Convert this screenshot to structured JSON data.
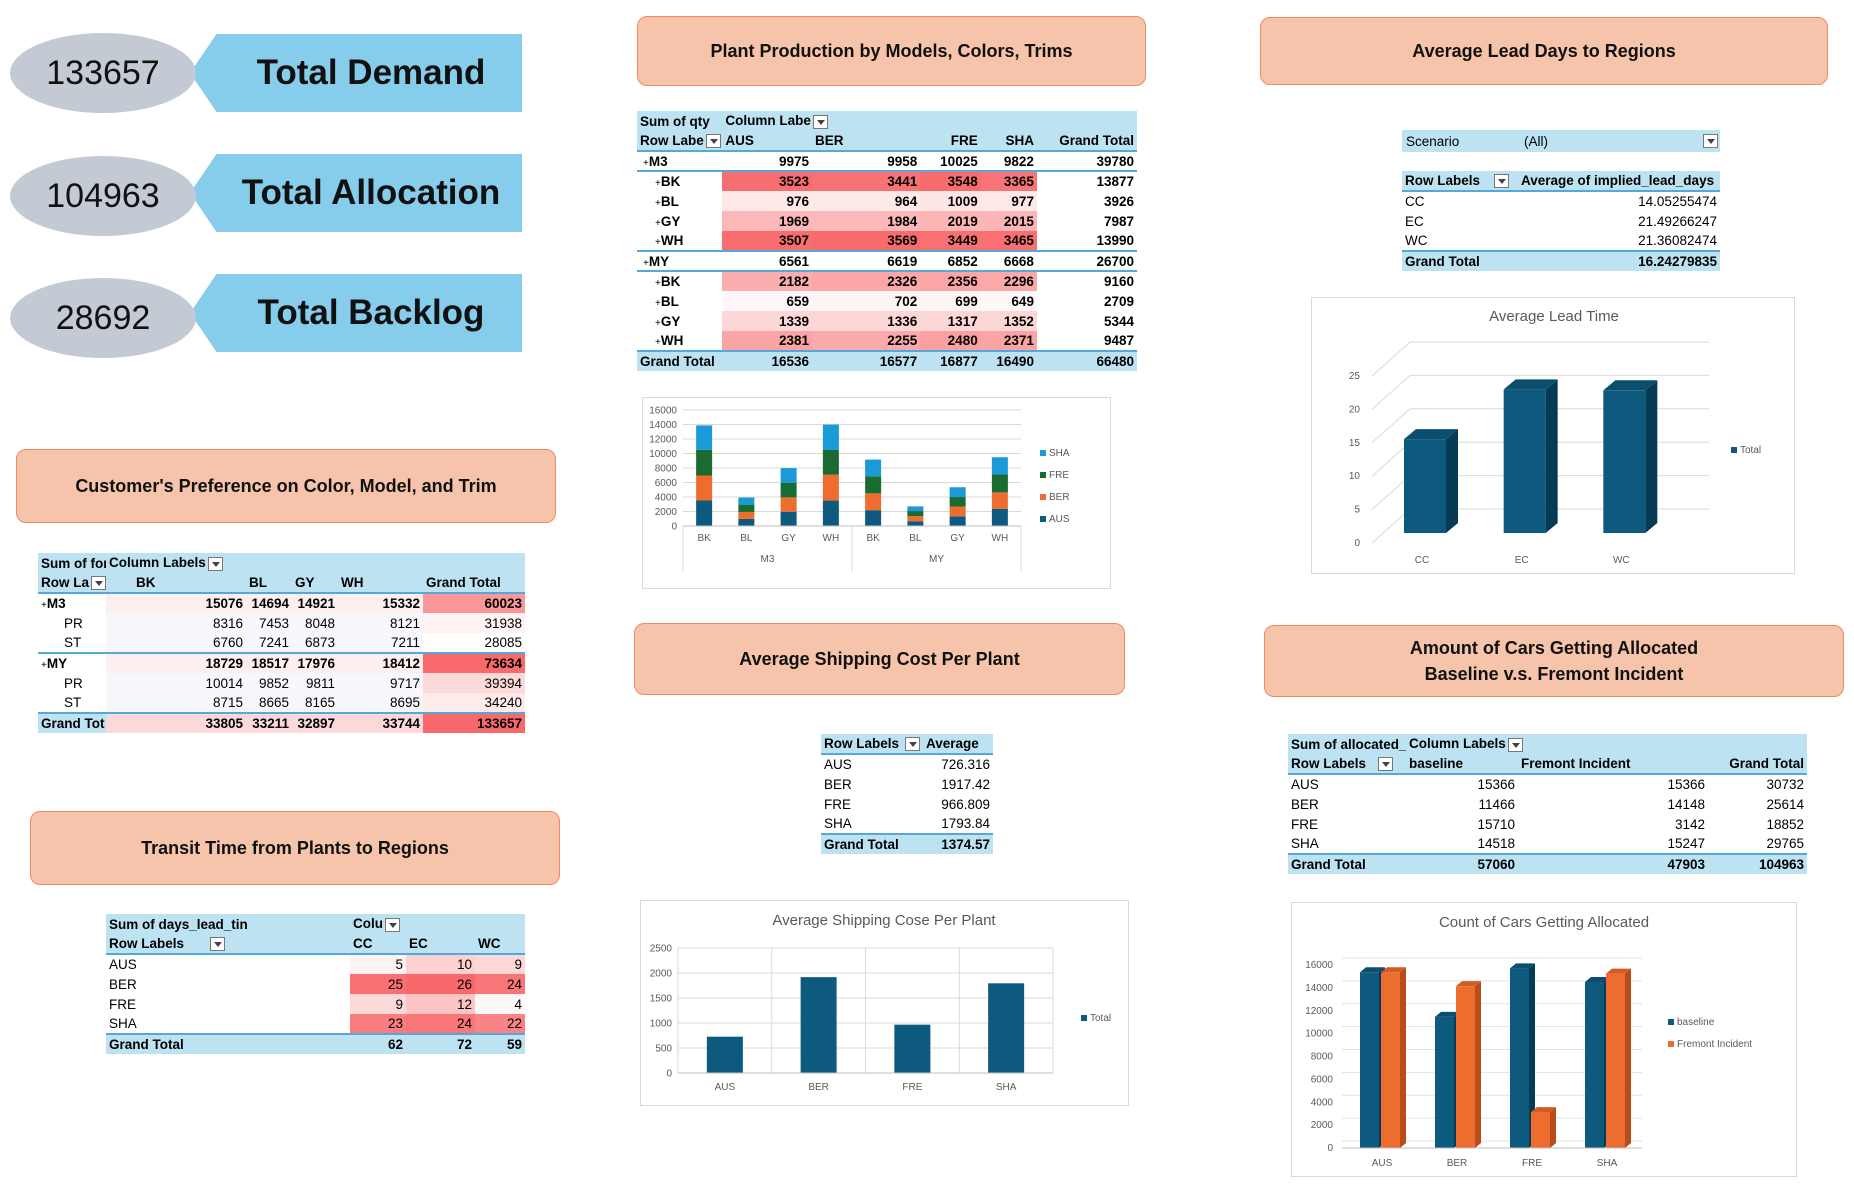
{
  "kpis": {
    "demand": {
      "value": "133657",
      "label": "Total Demand"
    },
    "allocation": {
      "value": "104963",
      "label": "Total Allocation"
    },
    "backlog": {
      "value": "28692",
      "label": "Total Backlog"
    }
  },
  "sections": {
    "customer_pref": "Customer's Preference on Color, Model, and Trim",
    "transit": "Transit Time from Plants to Regions",
    "plant_prod": "Plant Production by Models, Colors, Trims",
    "ship_cost": "Average Shipping Cost Per Plant",
    "lead_days": "Average Lead Days to Regions",
    "allocated_line1": "Amount of Cars Getting Allocated",
    "allocated_line2": "Baseline v.s. Fremont Incident"
  },
  "pref_table": {
    "corner": "Sum of for",
    "col_labels": "Column Labels",
    "row_labels": "Row La",
    "cols": [
      "BK",
      "BL",
      "GY",
      "WH",
      "Grand Total"
    ],
    "rows": [
      {
        "label": "M3",
        "values": [
          "15076",
          "14694",
          "14921",
          "15332",
          "60023"
        ]
      },
      {
        "label": "PR",
        "values": [
          "8316",
          "7453",
          "8048",
          "8121",
          "31938"
        ]
      },
      {
        "label": "ST",
        "values": [
          "6760",
          "7241",
          "6873",
          "7211",
          "28085"
        ]
      },
      {
        "label": "MY",
        "values": [
          "18729",
          "18517",
          "17976",
          "18412",
          "73634"
        ]
      },
      {
        "label": "PR",
        "values": [
          "10014",
          "9852",
          "9811",
          "9717",
          "39394"
        ]
      },
      {
        "label": "ST",
        "values": [
          "8715",
          "8665",
          "8165",
          "8695",
          "34240"
        ]
      },
      {
        "label": "Grand Tot",
        "values": [
          "33805",
          "33211",
          "32897",
          "33744",
          "133657"
        ]
      }
    ]
  },
  "transit_table": {
    "corner": "Sum of days_lead_tin",
    "col_labels": "Colu",
    "row_labels": "Row Labels",
    "cols": [
      "CC",
      "EC",
      "WC"
    ],
    "rows": [
      {
        "label": "AUS",
        "values": [
          "5",
          "10",
          "9"
        ]
      },
      {
        "label": "BER",
        "values": [
          "25",
          "26",
          "24"
        ]
      },
      {
        "label": "FRE",
        "values": [
          "9",
          "12",
          "4"
        ]
      },
      {
        "label": "SHA",
        "values": [
          "23",
          "24",
          "22"
        ]
      },
      {
        "label": "Grand Total",
        "values": [
          "62",
          "72",
          "59"
        ]
      }
    ]
  },
  "prod_table": {
    "corner": "Sum of qty",
    "col_labels": "Column Labe",
    "row_labels": "Row Labe",
    "cols": [
      "AUS",
      "BER",
      "FRE",
      "SHA",
      "Grand Total"
    ],
    "rows": [
      {
        "label": "M3",
        "values": [
          "9975",
          "9958",
          "10025",
          "9822",
          "39780"
        ]
      },
      {
        "label": "BK",
        "values": [
          "3523",
          "3441",
          "3548",
          "3365",
          "13877"
        ]
      },
      {
        "label": "BL",
        "values": [
          "976",
          "964",
          "1009",
          "977",
          "3926"
        ]
      },
      {
        "label": "GY",
        "values": [
          "1969",
          "1984",
          "2019",
          "2015",
          "7987"
        ]
      },
      {
        "label": "WH",
        "values": [
          "3507",
          "3569",
          "3449",
          "3465",
          "13990"
        ]
      },
      {
        "label": "MY",
        "values": [
          "6561",
          "6619",
          "6852",
          "6668",
          "26700"
        ]
      },
      {
        "label": "BK",
        "values": [
          "2182",
          "2326",
          "2356",
          "2296",
          "9160"
        ]
      },
      {
        "label": "BL",
        "values": [
          "659",
          "702",
          "699",
          "649",
          "2709"
        ]
      },
      {
        "label": "GY",
        "values": [
          "1339",
          "1336",
          "1317",
          "1352",
          "5344"
        ]
      },
      {
        "label": "WH",
        "values": [
          "2381",
          "2255",
          "2480",
          "2371",
          "9487"
        ]
      },
      {
        "label": "Grand Total",
        "values": [
          "16536",
          "16577",
          "16877",
          "16490",
          "66480"
        ]
      }
    ]
  },
  "ship_table": {
    "row_labels": "Row Labels",
    "col": "Average",
    "rows": [
      {
        "label": "AUS",
        "value": "726.316"
      },
      {
        "label": "BER",
        "value": "1917.42"
      },
      {
        "label": "FRE",
        "value": "966.809"
      },
      {
        "label": "SHA",
        "value": "1793.84"
      },
      {
        "label": "Grand Total",
        "value": "1374.57"
      }
    ]
  },
  "lead_table": {
    "filter_label": "Scenario",
    "filter_value": "(All)",
    "row_labels": "Row Labels",
    "col": "Average of implied_lead_days",
    "rows": [
      {
        "label": "CC",
        "value": "14.05255474"
      },
      {
        "label": "EC",
        "value": "21.49266247"
      },
      {
        "label": "WC",
        "value": "21.36082474"
      },
      {
        "label": "Grand Total",
        "value": "16.24279835"
      }
    ]
  },
  "alloc_table": {
    "corner": "Sum of allocated_",
    "col_labels": "Column Labels",
    "row_labels": "Row Labels",
    "cols": [
      "baseline",
      "Fremont Incident",
      "Grand Total"
    ],
    "rows": [
      {
        "label": "AUS",
        "values": [
          "15366",
          "15366",
          "30732"
        ]
      },
      {
        "label": "BER",
        "values": [
          "11466",
          "14148",
          "25614"
        ]
      },
      {
        "label": "FRE",
        "values": [
          "15710",
          "3142",
          "18852"
        ]
      },
      {
        "label": "SHA",
        "values": [
          "14518",
          "15247",
          "29765"
        ]
      },
      {
        "label": "Grand Total",
        "values": [
          "57060",
          "47903",
          "104963"
        ]
      }
    ]
  },
  "colors": {
    "navy": "#0e5a7e",
    "orange": "#ed6d2f",
    "green": "#1a6b32",
    "cyan": "#1a9ad7",
    "heat_strong": "#f8696b",
    "heat_light": "#fbc6c7"
  },
  "chart_data": [
    {
      "id": "prod_chart",
      "type": "bar",
      "stacked": true,
      "title": "",
      "categories": [
        "BK",
        "BL",
        "GY",
        "WH",
        "BK",
        "BL",
        "GY",
        "WH"
      ],
      "groups": [
        {
          "label": "M3",
          "span": 4
        },
        {
          "label": "MY",
          "span": 4
        }
      ],
      "series": [
        {
          "name": "AUS",
          "values": [
            3523,
            976,
            1969,
            3507,
            2182,
            659,
            1339,
            2381
          ]
        },
        {
          "name": "BER",
          "values": [
            3441,
            964,
            1984,
            3569,
            2326,
            702,
            1336,
            2255
          ]
        },
        {
          "name": "FRE",
          "values": [
            3548,
            1009,
            2019,
            3449,
            2356,
            699,
            1317,
            2480
          ]
        },
        {
          "name": "SHA",
          "values": [
            3365,
            977,
            2015,
            3465,
            2296,
            649,
            1352,
            2371
          ]
        }
      ],
      "ylim": [
        0,
        16000
      ],
      "yticks": [
        "0",
        "2000",
        "4000",
        "6000",
        "8000",
        "10000",
        "12000",
        "14000",
        "16000"
      ],
      "legend": "right"
    },
    {
      "id": "ship_chart",
      "type": "bar",
      "title": "Average Shipping Cose Per Plant",
      "categories": [
        "AUS",
        "BER",
        "FRE",
        "SHA"
      ],
      "series": [
        {
          "name": "Total",
          "values": [
            726.316,
            1917.42,
            966.809,
            1793.84
          ]
        }
      ],
      "ylim": [
        0,
        2500
      ],
      "yticks": [
        "0",
        "500",
        "1000",
        "1500",
        "2000",
        "2500"
      ],
      "legend": "right"
    },
    {
      "id": "lead_chart",
      "type": "bar",
      "style": "3d",
      "title": "Average Lead Time",
      "categories": [
        "CC",
        "EC",
        "WC"
      ],
      "series": [
        {
          "name": "Total",
          "values": [
            14.05255474,
            21.49266247,
            21.36082474
          ]
        }
      ],
      "ylim": [
        0,
        25
      ],
      "yticks": [
        "0",
        "5",
        "10",
        "15",
        "20",
        "25"
      ],
      "legend": "right"
    },
    {
      "id": "alloc_chart",
      "type": "bar",
      "style": "3d",
      "title": "Count of Cars Getting Allocated",
      "categories": [
        "AUS",
        "BER",
        "FRE",
        "SHA"
      ],
      "series": [
        {
          "name": "baseline",
          "values": [
            15366,
            11466,
            15710,
            14518
          ]
        },
        {
          "name": "Fremont Incident",
          "values": [
            15366,
            14148,
            3142,
            15247
          ]
        }
      ],
      "ylim": [
        0,
        16000
      ],
      "yticks": [
        "0",
        "2000",
        "4000",
        "6000",
        "8000",
        "10000",
        "12000",
        "14000",
        "16000"
      ],
      "legend": "right"
    }
  ]
}
